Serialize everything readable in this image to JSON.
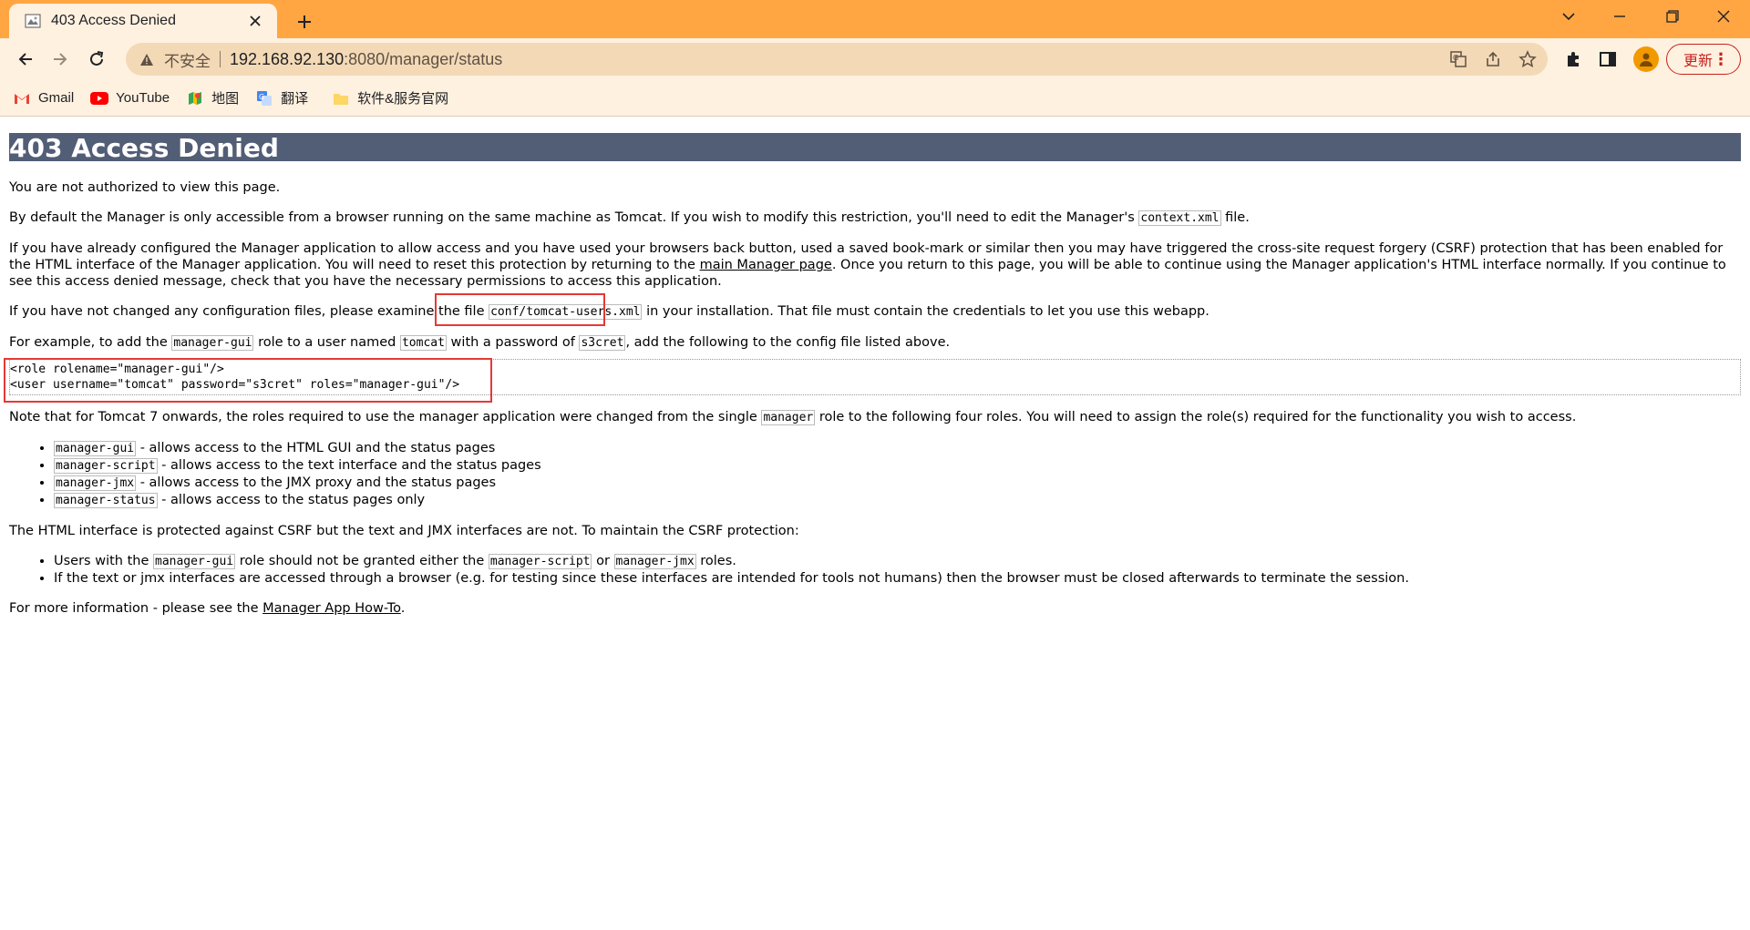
{
  "tab": {
    "title": "403 Access Denied",
    "favicon": "tomcat-favicon-icon"
  },
  "toolbar": {
    "insecure_label": "不安全",
    "url_host": "192.168.92.130",
    "url_rest": ":8080/manager/status",
    "update_label": "更新"
  },
  "bookmarks": [
    {
      "label": "Gmail",
      "icon": "gmail-icon"
    },
    {
      "label": "YouTube",
      "icon": "youtube-icon"
    },
    {
      "label": "地图",
      "icon": "maps-icon"
    },
    {
      "label": "翻译",
      "icon": "translate-icon"
    },
    {
      "label": "软件&服务官网",
      "icon": "folder-icon"
    }
  ],
  "page": {
    "heading": "403 Access Denied",
    "p1": "You are not authorized to view this page.",
    "p2_a": "By default the Manager is only accessible from a browser running on the same machine as Tomcat. If you wish to modify this restriction, you'll need to edit the Manager's ",
    "p2_code": "context.xml",
    "p2_b": " file.",
    "p3_a": "If you have already configured the Manager application to allow access and you have used your browsers back button, used a saved book-mark or similar then you may have triggered the cross-site request forgery (CSRF) protection that has been enabled for the HTML interface of the Manager application. You will need to reset this protection by returning to the ",
    "p3_link": "main Manager page",
    "p3_b": ". Once you return to this page, you will be able to continue using the Manager application's HTML interface normally. If you continue to see this access denied message, check that you have the necessary permissions to access this application.",
    "p4_a": "If you have not changed any configuration files, please examine the file ",
    "p4_code": "conf/tomcat-users.xml",
    "p4_b": " in your installation. That file must contain the credentials to let you use this webapp.",
    "p5_a": "For example, to add the ",
    "p5_code1": "manager-gui",
    "p5_b": " role to a user named ",
    "p5_code2": "tomcat",
    "p5_c": " with a password of ",
    "p5_code3": "s3cret",
    "p5_d": ", add the following to the config file listed above.",
    "example_line1": "<role rolename=\"manager-gui\"/>",
    "example_line2": "<user username=\"tomcat\" password=\"s3cret\" roles=\"manager-gui\"/>",
    "p6_a": "Note that for Tomcat 7 onwards, the roles required to use the manager application were changed from the single ",
    "p6_code": "manager",
    "p6_b": " role to the following four roles. You will need to assign the role(s) required for the functionality you wish to access.",
    "roles": [
      {
        "code": "manager-gui",
        "text": " - allows access to the HTML GUI and the status pages"
      },
      {
        "code": "manager-script",
        "text": " - allows access to the text interface and the status pages"
      },
      {
        "code": "manager-jmx",
        "text": " - allows access to the JMX proxy and the status pages"
      },
      {
        "code": "manager-status",
        "text": " - allows access to the status pages only"
      }
    ],
    "p7": "The HTML interface is protected against CSRF but the text and JMX interfaces are not. To maintain the CSRF protection:",
    "csrf1_a": "Users with the ",
    "csrf1_code1": "manager-gui",
    "csrf1_b": " role should not be granted either the ",
    "csrf1_code2": "manager-script",
    "csrf1_c": " or ",
    "csrf1_code3": "manager-jmx",
    "csrf1_d": " roles.",
    "csrf2": "If the text or jmx interfaces are accessed through a browser (e.g. for testing since these interfaces are intended for tools not humans) then the browser must be closed afterwards to terminate the session.",
    "p8_a": "For more information - please see the ",
    "p8_link": "Manager App How-To",
    "p8_b": "."
  },
  "colors": {
    "chrome": "#ffa642",
    "banner": "#525d76",
    "highlight": "#e53935"
  }
}
